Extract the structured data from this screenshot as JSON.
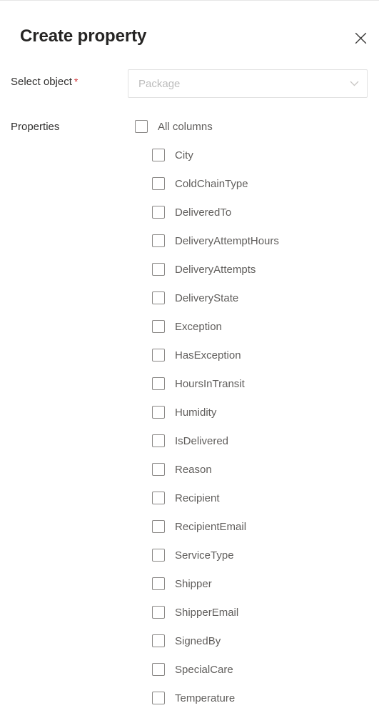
{
  "panel": {
    "title": "Create property",
    "close_icon": "close-icon"
  },
  "select_object": {
    "label": "Select object",
    "required_marker": "*",
    "placeholder": "Package",
    "value": "",
    "chevron_icon": "chevron-down-icon"
  },
  "properties": {
    "label": "Properties",
    "select_all": {
      "label": "All columns",
      "checked": false
    },
    "items": [
      {
        "label": "City",
        "checked": false
      },
      {
        "label": "ColdChainType",
        "checked": false
      },
      {
        "label": "DeliveredTo",
        "checked": false
      },
      {
        "label": "DeliveryAttemptHours",
        "checked": false
      },
      {
        "label": "DeliveryAttempts",
        "checked": false
      },
      {
        "label": "DeliveryState",
        "checked": false
      },
      {
        "label": "Exception",
        "checked": false
      },
      {
        "label": "HasException",
        "checked": false
      },
      {
        "label": "HoursInTransit",
        "checked": false
      },
      {
        "label": "Humidity",
        "checked": false
      },
      {
        "label": "IsDelivered",
        "checked": false
      },
      {
        "label": "Reason",
        "checked": false
      },
      {
        "label": "Recipient",
        "checked": false
      },
      {
        "label": "RecipientEmail",
        "checked": false
      },
      {
        "label": "ServiceType",
        "checked": false
      },
      {
        "label": "Shipper",
        "checked": false
      },
      {
        "label": "ShipperEmail",
        "checked": false
      },
      {
        "label": "SignedBy",
        "checked": false
      },
      {
        "label": "SpecialCare",
        "checked": false
      },
      {
        "label": "Temperature",
        "checked": false
      }
    ]
  },
  "colors": {
    "title_text": "#252423",
    "label_text": "#323130",
    "item_text": "#605e5c",
    "placeholder_text": "#bcbcbc",
    "required_star": "#d13438",
    "checkbox_border": "#8a8886",
    "field_border": "#e1e1e1",
    "background": "#ffffff"
  }
}
